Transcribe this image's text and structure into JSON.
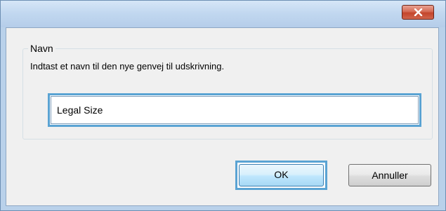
{
  "dialog": {
    "close_icon": "close-icon"
  },
  "group": {
    "legend": "Navn",
    "description": "Indtast et navn til den nye genvej til udskrivning."
  },
  "name_field": {
    "value": "Legal Size"
  },
  "buttons": {
    "ok_label": "OK",
    "cancel_label": "Annuller"
  }
}
